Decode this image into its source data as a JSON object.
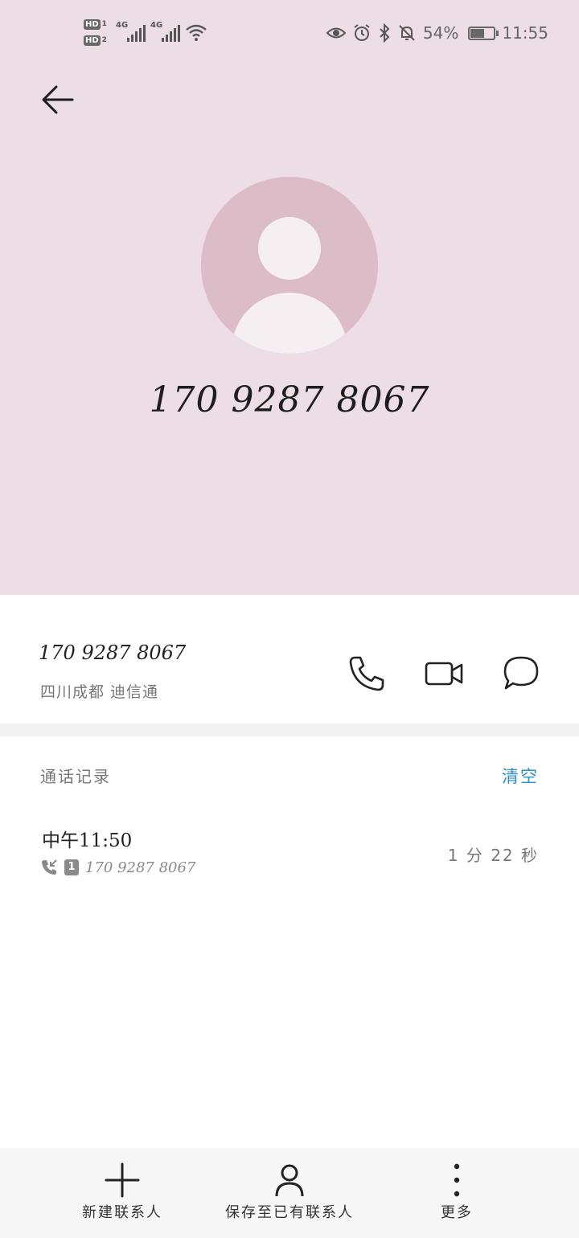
{
  "status_bar": {
    "sim1_badge": "HD",
    "sim1_num": "1",
    "sim2_badge": "HD",
    "sim2_num": "2",
    "network1": "4G",
    "network2": "4G",
    "battery_percent": "54%",
    "battery_level": 0.54,
    "time": "11:55",
    "icons": [
      "eye-icon",
      "alarm-icon",
      "bluetooth-icon",
      "mute-bell-icon",
      "battery-icon"
    ]
  },
  "header": {
    "back_icon": "arrow-left-icon"
  },
  "contact": {
    "display_number": "170 9287 8067",
    "number": "170 9287 8067",
    "location": "四川成都 迪信通"
  },
  "actions": [
    {
      "icon": "phone-icon"
    },
    {
      "icon": "video-call-icon"
    },
    {
      "icon": "message-icon"
    }
  ],
  "call_log": {
    "title": "通话记录",
    "clear_label": "清空",
    "entries": [
      {
        "time": "中午11:50",
        "sim": "1",
        "number": "170 9287 8067",
        "duration": "1 分 22 秒",
        "icon": "incoming-call-icon"
      }
    ]
  },
  "bottom_bar": {
    "items": [
      {
        "label": "新建联系人",
        "icon": "plus-icon"
      },
      {
        "label": "保存至已有联系人",
        "icon": "person-icon"
      },
      {
        "label": "更多",
        "icon": "more-vertical-icon"
      }
    ]
  },
  "colors": {
    "hero_bg": "#eddde4",
    "avatar_bg": "#dcbcc6",
    "accent": "#2b8fc4"
  }
}
